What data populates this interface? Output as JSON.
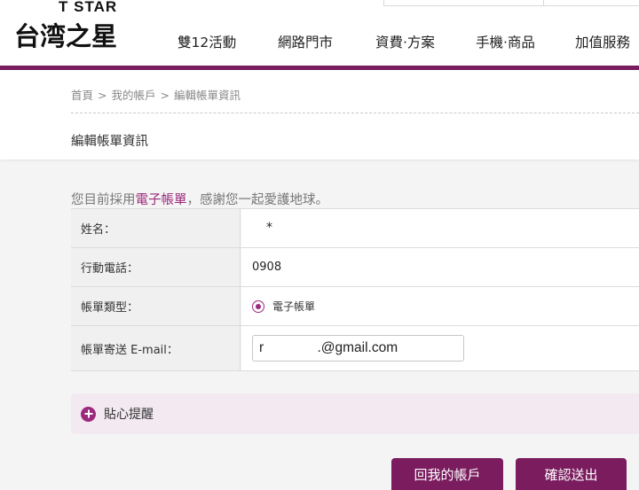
{
  "header": {
    "logo_en": "T STAR",
    "logo_zh": "台湾之星",
    "nav": [
      {
        "label": "雙12活動"
      },
      {
        "label": "網路門市"
      },
      {
        "label": "資費‧方案"
      },
      {
        "label": "手機‧商品"
      },
      {
        "label": "加值服務"
      }
    ]
  },
  "breadcrumb": {
    "items": [
      "首頁",
      "我的帳戶",
      "編輯帳單資訊"
    ],
    "separator": ">"
  },
  "page_title": "編輯帳單資訊",
  "notice": {
    "prefix": "您目前採用",
    "highlight": "電子帳單",
    "suffix": "，感謝您一起愛護地球。"
  },
  "form": {
    "name_label": "姓名：",
    "name_value": "*",
    "phone_label": "行動電話：",
    "phone_value": "0908",
    "bill_type_label": "帳單類型：",
    "bill_type_option": "電子帳單",
    "email_label": "帳單寄送 E-mail：",
    "email_value": "r              .@gmail.com"
  },
  "tips": {
    "label": "貼心提醒",
    "icon": "plus-circle-icon"
  },
  "buttons": {
    "back": "回我的帳戶",
    "submit": "確認送出"
  },
  "colors": {
    "brand": "#7a1c5e",
    "accent": "#9b2a7c",
    "tips_bg": "#f3e9f0"
  }
}
